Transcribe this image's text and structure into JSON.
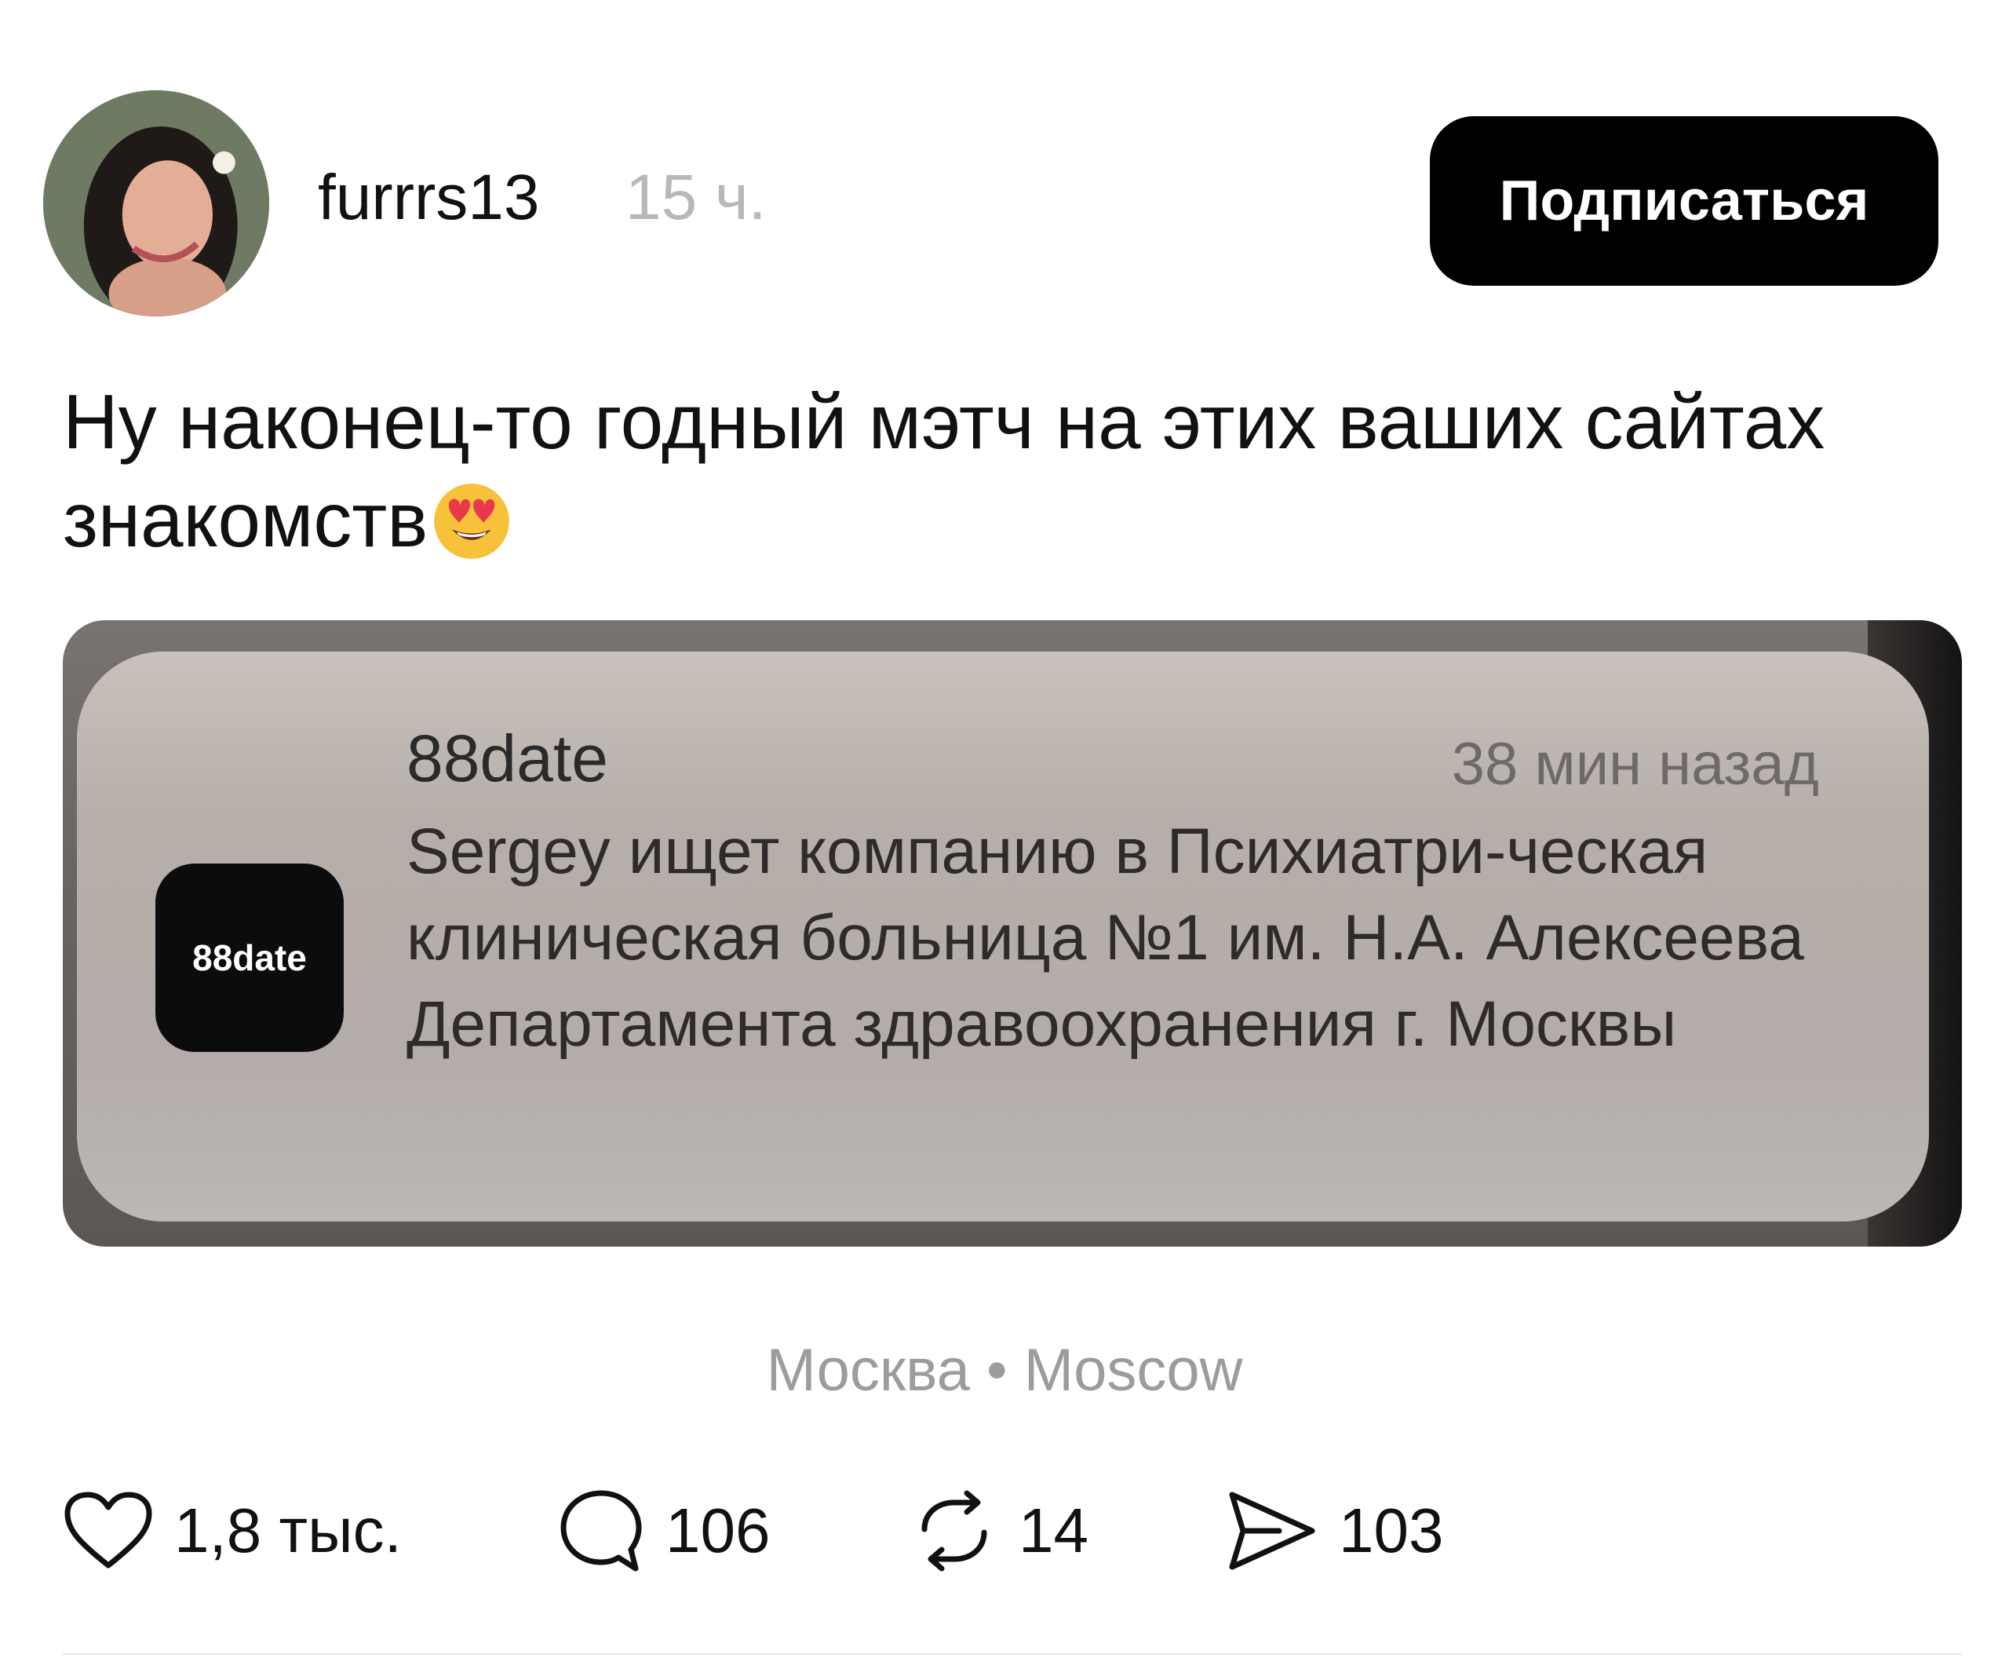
{
  "post": {
    "author": "furrrs13",
    "time": "15 ч.",
    "follow_label": "Подписаться",
    "text": "Ну наконец-то годный мэтч на этих ваших сайтах знакомств",
    "emoji": "heart-eyes-emoji",
    "location": "Москва • Moscow"
  },
  "notification": {
    "app_name": "88date",
    "app_icon_label": "88date",
    "time": "38 мин назад",
    "body": "Sergey ищет компанию в Психиатри-ческая клиническая больница №1 им. Н.А. Алексеева Департамента здравоохранения г. Москвы"
  },
  "actions": {
    "likes": "1,8 тыс.",
    "comments": "106",
    "reposts": "14",
    "shares": "103"
  },
  "icons": {
    "like": "heart-icon",
    "comment": "comment-icon",
    "repost": "repost-icon",
    "share": "send-icon"
  }
}
